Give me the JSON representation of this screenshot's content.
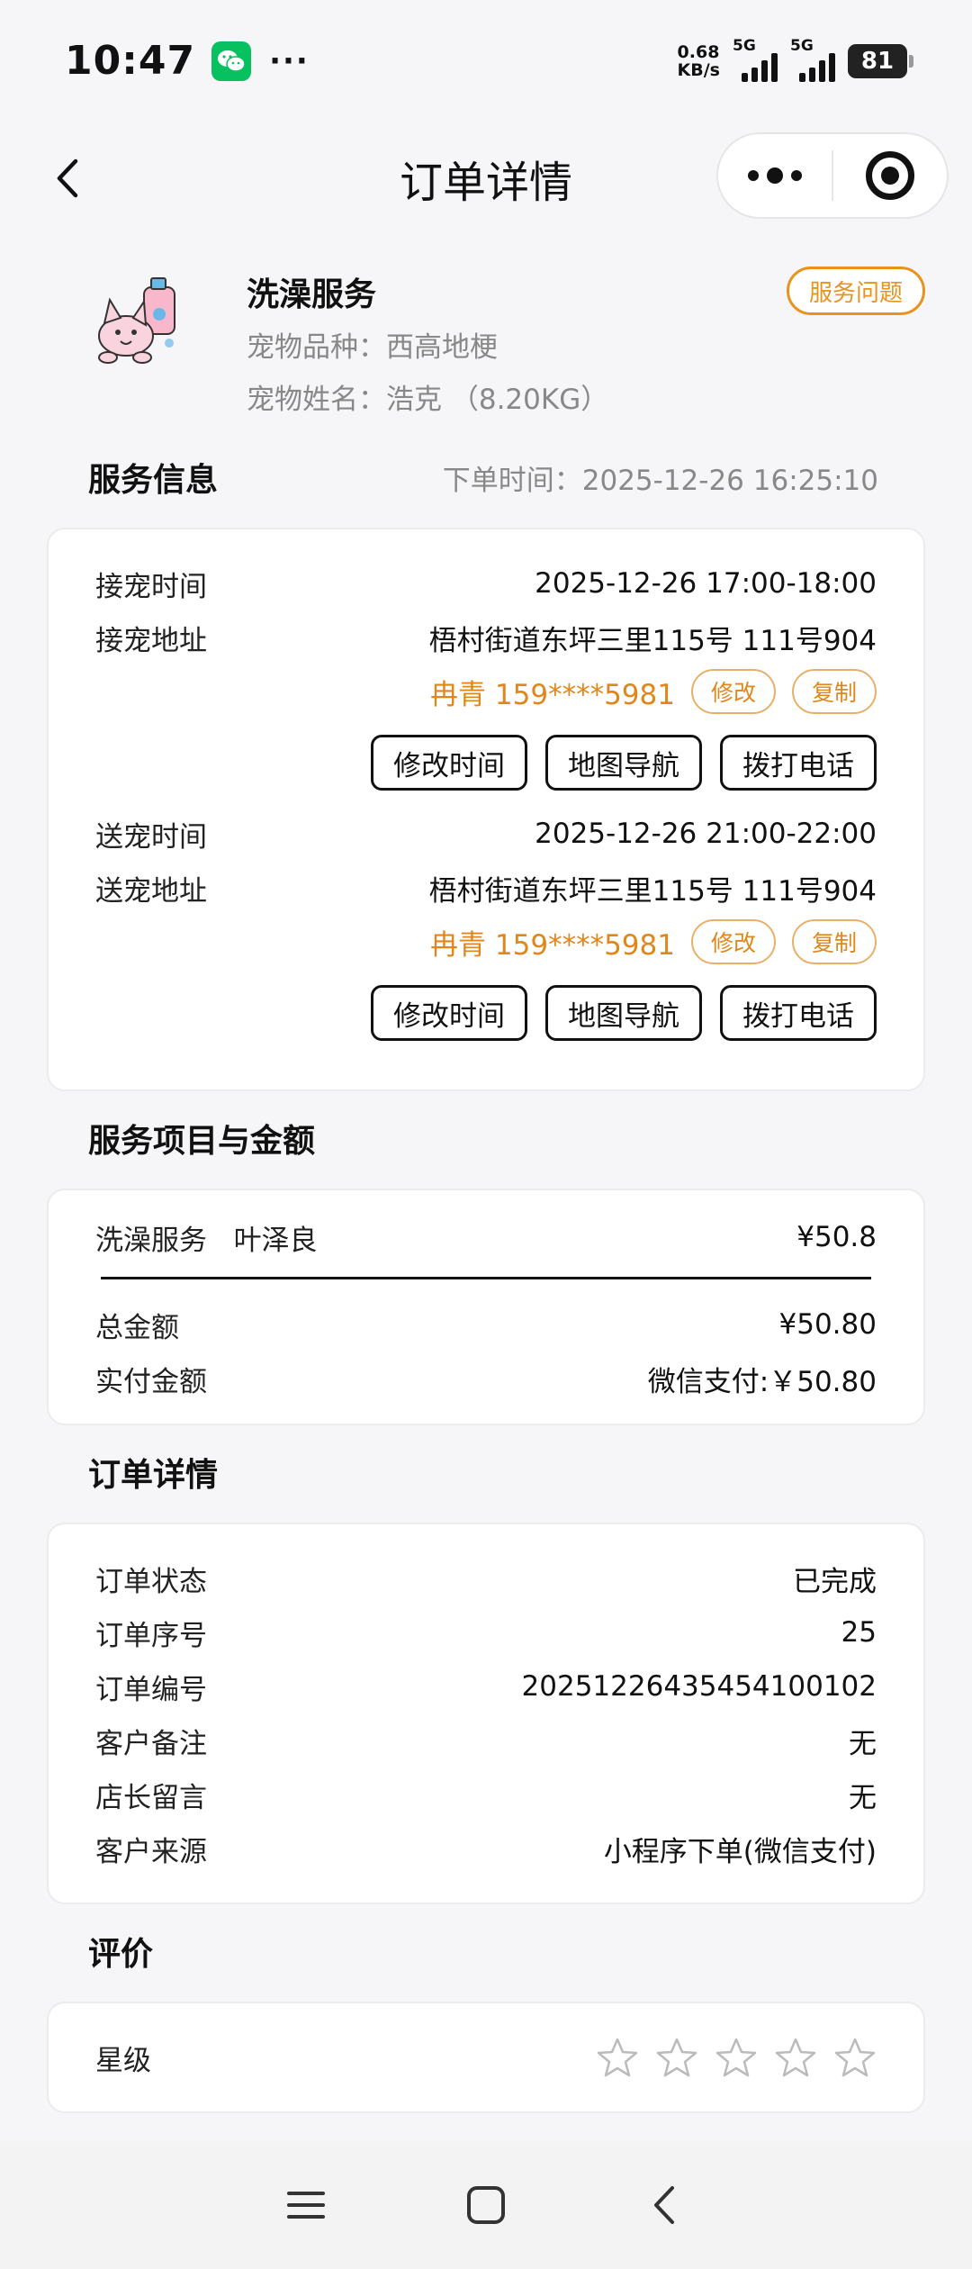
{
  "status_bar": {
    "time": "10:47",
    "net_speed_value": "0.68",
    "net_speed_unit": "KB/s",
    "sim1": "5G",
    "sim2": "5G",
    "battery": "81",
    "wechat_icon": "wechat-icon"
  },
  "navbar": {
    "title": "订单详情"
  },
  "pet": {
    "service": "洗澡服务",
    "breed_label": "宠物品种：",
    "breed": "西高地梗",
    "name_label": "宠物姓名：",
    "name": "浩克",
    "weight": "（8.20KG）",
    "issue_button": "服务问题"
  },
  "service_info": {
    "title": "服务信息",
    "order_time_label": "下单时间：",
    "order_time": "2025-12-26 16:25:10",
    "pickup": {
      "time_label": "接宠时间",
      "time": "2025-12-26 17:00-18:00",
      "address_label": "接宠地址",
      "address": "梧村街道东坪三里115号 111号904",
      "contact": "冉青 159****5981",
      "edit": "修改",
      "copy": "复制",
      "btn_edit_time": "修改时间",
      "btn_map": "地图导航",
      "btn_call": "拨打电话"
    },
    "dropoff": {
      "time_label": "送宠时间",
      "time": "2025-12-26 21:00-22:00",
      "address_label": "送宠地址",
      "address": "梧村街道东坪三里115号 111号904",
      "contact": "冉青 159****5981",
      "edit": "修改",
      "copy": "复制",
      "btn_edit_time": "修改时间",
      "btn_map": "地图导航",
      "btn_call": "拨打电话"
    }
  },
  "amount": {
    "title": "服务项目与金额",
    "item_name": "洗澡服务",
    "staff": "叶泽良",
    "item_price": "¥50.8",
    "total_label": "总金额",
    "total": "¥50.80",
    "paid_label": "实付金额",
    "paid": "微信支付:￥50.80"
  },
  "order": {
    "title": "订单详情",
    "rows": [
      {
        "k": "订单状态",
        "v": "已完成"
      },
      {
        "k": "订单序号",
        "v": "25"
      },
      {
        "k": "订单编号",
        "v": "20251226435454100102"
      },
      {
        "k": "客户备注",
        "v": "无"
      },
      {
        "k": "店长留言",
        "v": "无"
      },
      {
        "k": "客户来源",
        "v": "小程序下单(微信支付)"
      }
    ]
  },
  "review": {
    "title": "评价",
    "stars_label": "星级",
    "rating": 0,
    "max": 5
  },
  "colors": {
    "accent": "#e0861a",
    "bg": "#f6f6f8"
  }
}
